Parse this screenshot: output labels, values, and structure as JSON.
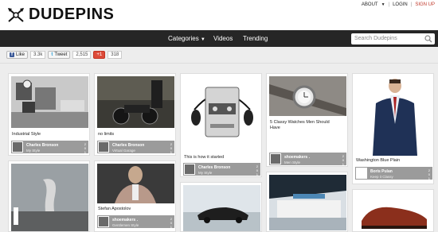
{
  "brand": {
    "name": "DUDEPINS"
  },
  "top_links": {
    "about": "ABOUT",
    "login": "LOGIN",
    "signup": "SIGN UP",
    "sep": "|"
  },
  "nav": {
    "categories": "Categories",
    "videos": "Videos",
    "trending": "Trending"
  },
  "search": {
    "placeholder": "Search Dudepins"
  },
  "social": {
    "like_label": "Like",
    "like_count": "3.3k",
    "tweet_label": "Tweet",
    "tweet_count": "2,515",
    "gplus_label": "+1",
    "gplus_count": "318"
  },
  "cards": [
    {
      "caption": "Industrial Style",
      "user": "Charles Bronson",
      "board": "My Style",
      "stats": "2\n0\n1"
    },
    {
      "caption": "no limits",
      "user": "Charles Bronson",
      "board": "Virtual Garage",
      "stats": "2\n0\n1"
    },
    {
      "caption": "This is how it started",
      "user": "Charles Bronson",
      "board": "My Style",
      "stats": "2\n0\n1"
    },
    {
      "caption": "5 Classy Watches Men Should Have",
      "user": "shoemakers .",
      "board": "Men Style",
      "stats": "2\n0\n1"
    },
    {
      "caption": "Washington Blue Plain",
      "user": "Boris Pulan",
      "board": "Keep it Classy",
      "stats": "2\n0\n1"
    },
    {
      "caption": "Stefan Apostolov",
      "user": "shoemakers .",
      "board": "Gentlemen Style",
      "stats": "2\n0\n1"
    }
  ],
  "colors": {
    "navbar": "#262626",
    "meta_bar": "#9b9b9b",
    "signup": "#c0392b"
  }
}
